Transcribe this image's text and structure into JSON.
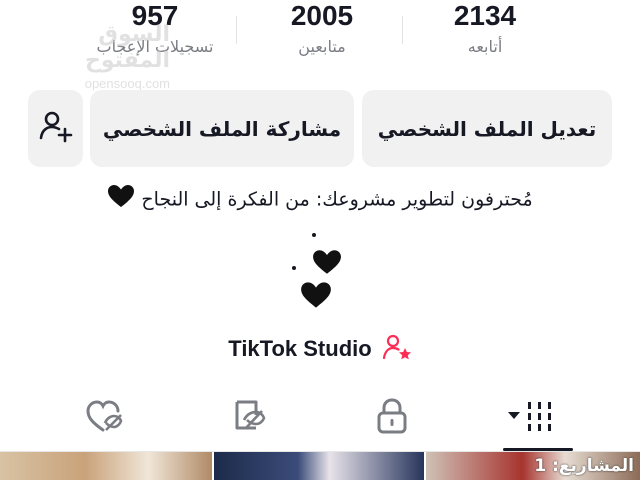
{
  "stats": {
    "likes": {
      "value": "957",
      "label": "تسجيلات الإعجاب"
    },
    "followers": {
      "value": "2005",
      "label": "متابعين"
    },
    "following": {
      "value": "2134",
      "label": "أتابعه"
    }
  },
  "watermark": {
    "arabic": "السوق المفتوح",
    "latin": "opensooq.com"
  },
  "actions": {
    "edit_profile": "تعديل الملف الشخصي",
    "share_profile": "مشاركة الملف الشخصي",
    "add_friend_icon": "person-add-icon"
  },
  "bio": {
    "line1": "مُحترفون لتطوير مشروعك: من الفكرة إلى النجاح",
    "heart_icon": "black-heart-icon"
  },
  "profile": {
    "name": "TikTok Studio",
    "badge_icon": "person-star-icon",
    "badge_color": "#fe2c55"
  },
  "tabs": [
    {
      "name": "videos",
      "icon": "grid-bars-icon",
      "active": true
    },
    {
      "name": "private",
      "icon": "lock-icon",
      "active": false
    },
    {
      "name": "reposts",
      "icon": "repost-icon",
      "active": false
    },
    {
      "name": "liked",
      "icon": "liked-heart-icon",
      "active": false
    }
  ],
  "grid": {
    "third_thumb_label": "المشاريع: 1"
  },
  "colors": {
    "text": "#161823",
    "muted": "#7b7d84",
    "button_bg": "#f1f1f2",
    "accent": "#fe2c55"
  }
}
